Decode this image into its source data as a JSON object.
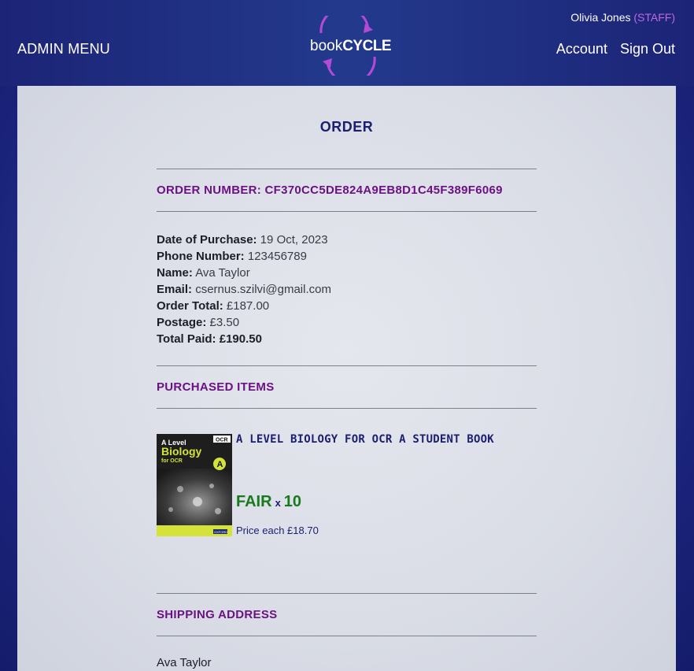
{
  "header": {
    "admin_menu": "ADMIN MENU",
    "user_name": "Olivia Jones",
    "user_role": "(STAFF)",
    "nav": [
      "Account",
      "Sign Out"
    ],
    "logo": {
      "book": "book",
      "cycle": "CYCLE"
    }
  },
  "order": {
    "title": "ORDER",
    "number_heading": "ORDER NUMBER: CF370CC5DE824A9EB8D1C45F389F6069",
    "details": [
      {
        "label": "Date of Purchase:",
        "value": "19 Oct, 2023"
      },
      {
        "label": "Phone Number:",
        "value": "123456789"
      },
      {
        "label": "Name:",
        "value": "Ava Taylor"
      },
      {
        "label": "Email:",
        "value": "csernus.szilvi@gmail.com"
      },
      {
        "label": "Order Total:",
        "value": "£187.00"
      },
      {
        "label": "Postage:",
        "value": "£3.50"
      },
      {
        "label": "Total Paid:",
        "value": "£190.50"
      }
    ],
    "items_heading": "PURCHASED ITEMS",
    "items": [
      {
        "title": "A LEVEL BIOLOGY FOR OCR A STUDENT BOOK",
        "condition": "FAIR",
        "x": "x",
        "quantity": "10",
        "price": "Price each £18.70",
        "cover": {
          "publisher": "OCR",
          "line1": "A Level",
          "line2": "Biology",
          "line3": "for OCR",
          "badge": "A",
          "oxford": "OXFORD"
        }
      }
    ],
    "shipping_heading": "SHIPPING ADDRESS",
    "shipping_name": "Ava Taylor"
  },
  "colors": {
    "nav_bg": "#1c2477",
    "staff_accent": "#c168e0",
    "heading_purple": "#6b1283",
    "title_navy": "#1b1f6e",
    "condition_green": "#187a1c"
  }
}
